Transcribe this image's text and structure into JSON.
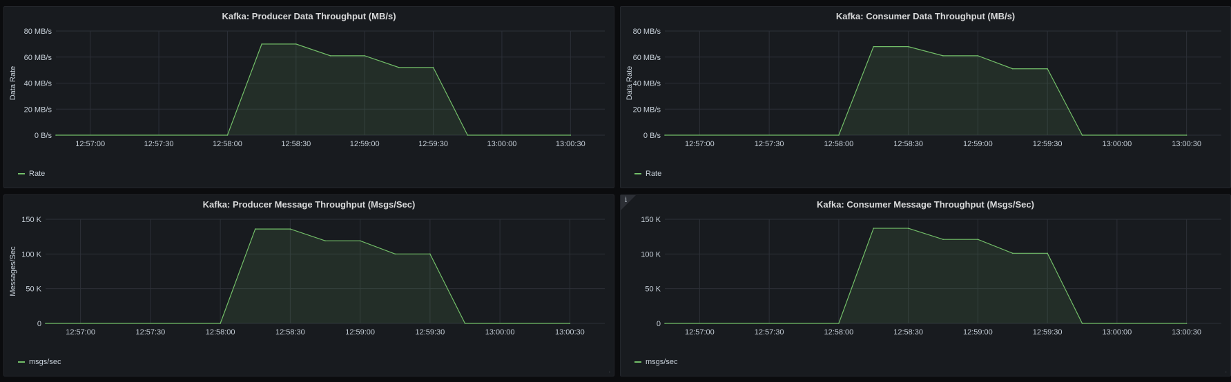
{
  "x_ticks": [
    "12:57:00",
    "12:57:30",
    "12:58:00",
    "12:58:30",
    "12:59:00",
    "12:59:30",
    "13:00:00",
    "13:00:30"
  ],
  "colors": {
    "series": "#73bf69",
    "grid": "#2c3038",
    "text": "#c7d0d9",
    "panel": "#181b1f"
  },
  "panels": [
    {
      "title": "Kafka: Producer Data Throughput (MB/s)",
      "legend": "Rate",
      "chart_data": {
        "type": "area",
        "title": "Kafka: Producer Data Throughput (MB/s)",
        "ylabel": "Data Rate",
        "ylim": [
          0,
          80
        ],
        "yticks": [
          {
            "v": 0,
            "label": "0 B/s"
          },
          {
            "v": 20,
            "label": "20 MB/s"
          },
          {
            "v": 40,
            "label": "40 MB/s"
          },
          {
            "v": 60,
            "label": "60 MB/s"
          },
          {
            "v": 80,
            "label": "80 MB/s"
          }
        ],
        "xlim": [
          "12:56:45",
          "13:00:45"
        ],
        "series": [
          {
            "name": "Rate",
            "x": [
              "12:56:45",
              "12:58:00",
              "12:58:15",
              "12:58:30",
              "12:58:45",
              "12:59:00",
              "12:59:15",
              "12:59:30",
              "12:59:45",
              "13:00:30"
            ],
            "y": [
              0,
              0,
              70,
              70,
              61,
              61,
              52,
              52,
              0,
              0
            ]
          }
        ]
      }
    },
    {
      "title": "Kafka: Consumer Data Throughput (MB/s)",
      "legend": "Rate",
      "chart_data": {
        "type": "area",
        "title": "Kafka: Consumer Data Throughput (MB/s)",
        "ylabel": "Data Rate",
        "ylim": [
          0,
          80
        ],
        "yticks": [
          {
            "v": 0,
            "label": "0 B/s"
          },
          {
            "v": 20,
            "label": "20 MB/s"
          },
          {
            "v": 40,
            "label": "40 MB/s"
          },
          {
            "v": 60,
            "label": "60 MB/s"
          },
          {
            "v": 80,
            "label": "80 MB/s"
          }
        ],
        "xlim": [
          "12:56:45",
          "13:00:45"
        ],
        "series": [
          {
            "name": "Rate",
            "x": [
              "12:56:45",
              "12:58:00",
              "12:58:15",
              "12:58:30",
              "12:58:45",
              "12:59:00",
              "12:59:15",
              "12:59:30",
              "12:59:45",
              "13:00:30"
            ],
            "y": [
              0,
              0,
              68,
              68,
              61,
              61,
              51,
              51,
              0,
              0
            ]
          }
        ]
      }
    },
    {
      "title": "Kafka: Producer Message Throughput (Msgs/Sec)",
      "legend": "msgs/sec",
      "chart_data": {
        "type": "area",
        "title": "Kafka: Producer Message Throughput (Msgs/Sec)",
        "ylabel": "Messages/Sec",
        "ylim": [
          0,
          150000
        ],
        "yticks": [
          {
            "v": 0,
            "label": "0"
          },
          {
            "v": 50000,
            "label": "50 K"
          },
          {
            "v": 100000,
            "label": "100 K"
          },
          {
            "v": 150000,
            "label": "150 K"
          }
        ],
        "xlim": [
          "12:56:45",
          "13:00:45"
        ],
        "series": [
          {
            "name": "msgs/sec",
            "x": [
              "12:56:45",
              "12:58:00",
              "12:58:15",
              "12:58:30",
              "12:58:45",
              "12:59:00",
              "12:59:15",
              "12:59:30",
              "12:59:45",
              "13:00:30"
            ],
            "y": [
              0,
              0,
              136000,
              136000,
              119000,
              119000,
              100000,
              100000,
              0,
              0
            ]
          }
        ]
      }
    },
    {
      "title": "Kafka: Consumer Message Throughput (Msgs/Sec)",
      "legend": "msgs/sec",
      "info": "i",
      "chart_data": {
        "type": "area",
        "title": "Kafka: Consumer Message Throughput (Msgs/Sec)",
        "ylabel": "",
        "ylim": [
          0,
          150000
        ],
        "yticks": [
          {
            "v": 0,
            "label": "0"
          },
          {
            "v": 50000,
            "label": "50 K"
          },
          {
            "v": 100000,
            "label": "100 K"
          },
          {
            "v": 150000,
            "label": "150 K"
          }
        ],
        "xlim": [
          "12:56:45",
          "13:00:45"
        ],
        "series": [
          {
            "name": "msgs/sec",
            "x": [
              "12:56:45",
              "12:58:00",
              "12:58:15",
              "12:58:30",
              "12:58:45",
              "12:59:00",
              "12:59:15",
              "12:59:30",
              "12:59:45",
              "13:00:30"
            ],
            "y": [
              0,
              0,
              137000,
              137000,
              121000,
              121000,
              101000,
              101000,
              0,
              0
            ]
          }
        ]
      }
    }
  ]
}
